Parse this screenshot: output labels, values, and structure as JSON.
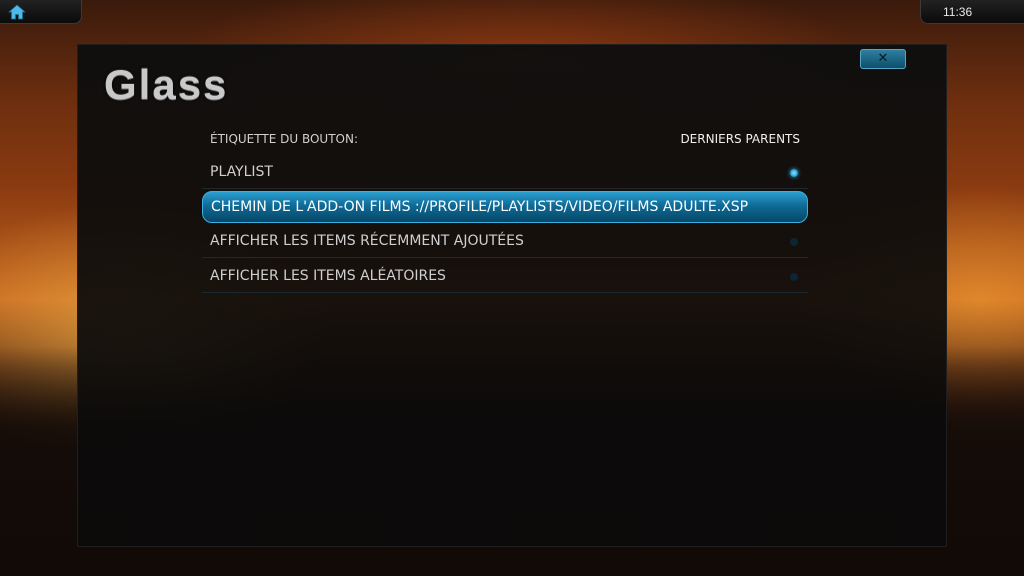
{
  "statusbar": {
    "home_icon": "home-icon",
    "clock": "11:36"
  },
  "dialog": {
    "title": "Glass",
    "close_icon": "close-icon",
    "close_label": "✕",
    "header": {
      "label": "ÉTIQUETTE DU BOUTON:",
      "value": "DERNIERS PARENTS"
    },
    "items": [
      {
        "label": "PLAYLIST",
        "selected": false,
        "radio_on": true
      },
      {
        "label": "CHEMIN DE L'ADD-ON FILMS  ://PROFILE/PLAYLISTS/VIDEO/FILMS ADULTE.XSP",
        "selected": true,
        "radio_on": false
      },
      {
        "label": "AFFICHER LES ITEMS RÉCEMMENT AJOUTÉES",
        "selected": false,
        "radio_on": false
      },
      {
        "label": "AFFICHER LES ITEMS ALÉATOIRES",
        "selected": false,
        "radio_on": false
      }
    ]
  },
  "colors": {
    "accent": "#2aa8e0",
    "selected_bg": "#0f6b98"
  }
}
